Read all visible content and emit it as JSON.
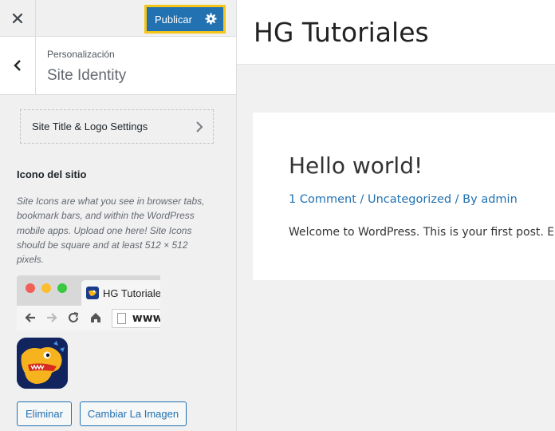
{
  "topbar": {
    "close_icon": "close-icon",
    "publish_label": "Publicar",
    "publish_settings_icon": "gear-icon"
  },
  "section": {
    "breadcrumb": "Personalización",
    "title": "Site Identity",
    "back_icon": "chevron-left-icon"
  },
  "logo_settings": {
    "label": "Site Title & Logo Settings",
    "icon": "chevron-right-icon"
  },
  "site_icon": {
    "label": "Icono del sitio",
    "description": "Site Icons are what you see in browser tabs, bookmark bars, and within the WordPress mobile apps. Upload one here! Site Icons should be square and at least 512 × 512 pixels.",
    "browser_tab_title": "HG Tutoriales",
    "browser_url": "www.",
    "remove_label": "Eliminar",
    "change_label": "Cambiar La Imagen"
  },
  "preview": {
    "site_title": "HG Tutoriales",
    "post_title": "Hello world!",
    "meta": {
      "comments": "1 Comment",
      "sep1": " / ",
      "category": "Uncategorized",
      "sep2": " / By ",
      "author": "admin"
    },
    "excerpt": "Welcome to WordPress. This is your first post. Edit"
  },
  "colors": {
    "accent": "#2271b1",
    "highlight": "#f5c518",
    "sidebar_bg": "#f0f0f1"
  }
}
